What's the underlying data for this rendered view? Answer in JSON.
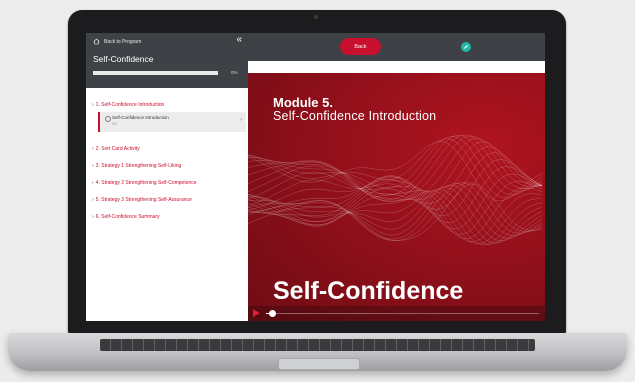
{
  "sidebar": {
    "back_label": "Back to Program",
    "collapse_glyph": "«",
    "course_title": "Self-Confidence",
    "progress_percent": 0,
    "progress_label": "0%",
    "lessons": [
      {
        "label": "1. Self-Confidence Introduction"
      },
      {
        "label": "2. Sort Card Activity"
      },
      {
        "label": "3. Strategy 1 Strengthening Self-Liking"
      },
      {
        "label": "4. Strategy 2 Strengthening Self-Competence"
      },
      {
        "label": "5. Strategy 3 Strengthening Self-Assurance"
      },
      {
        "label": "6. Self-Confidence Summary"
      }
    ],
    "active_sub": {
      "title": "Self-Confidence Introduction",
      "meta": "0/0"
    }
  },
  "topbar": {
    "back_button": "Back",
    "edit_icon": "pencil-icon"
  },
  "video": {
    "module_label": "Module 5.",
    "module_subtitle": "Self-Confidence Introduction",
    "big_title": "Self-Confidence",
    "accent_color": "#c8102e",
    "playback_fraction": 0.02
  },
  "icons": {
    "home": "home-icon",
    "collapse": "double-chevron-left-icon",
    "play": "play-icon"
  },
  "colors": {
    "header": "#3e4146",
    "accent": "#c8102e",
    "edit": "#21b6a8"
  }
}
